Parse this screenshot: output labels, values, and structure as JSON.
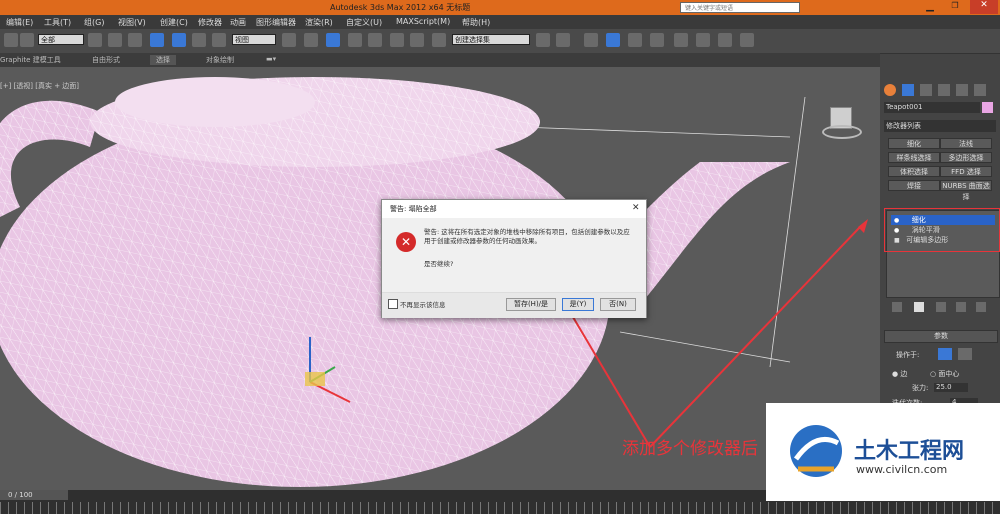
{
  "window": {
    "title": "Autodesk 3ds Max  2012 x64     无标题",
    "search_placeholder": "键入关键字或短语"
  },
  "menu": [
    "编辑(E)",
    "工具(T)",
    "组(G)",
    "视图(V)",
    "创建(C)",
    "修改器",
    "动画",
    "图形编辑器",
    "渲染(R)",
    "自定义(U)",
    "MAXScript(M)",
    "帮助(H)"
  ],
  "toolbar": {
    "selection_filter": "全部",
    "ref_coord": "视图",
    "named_selection": "创建选择集"
  },
  "ribbon": [
    "Graphite 建模工具",
    "自由形式",
    "选择",
    "对象绘制"
  ],
  "viewport": {
    "label": "[+] [透视] [真实 + 边面]"
  },
  "command_panel": {
    "object_name": "Teapot001",
    "modifier_list": "修改器列表",
    "buttons": [
      "细化",
      "法线",
      "样条线选择",
      "多边形选择",
      "体积选择",
      "FFD 选择",
      "焊接",
      "NURBS 曲面选择"
    ],
    "stack": [
      "细化",
      "涡轮平滑",
      "可编辑多边形"
    ],
    "rollout_title": "参数",
    "operate_on": "操作于:",
    "edge": "边",
    "face_center": "面中心",
    "tension_label": "张力:",
    "tension_value": "25.0",
    "iterations_label": "迭代次数:",
    "iterations_value": "4"
  },
  "dialog": {
    "title": "警告: 塌陷全部",
    "message": "警告: 这将在所有选定对象的堆栈中移除所有项目，包括创建参数以及应用于创建或修改器参数的任何动画效果。",
    "question": "是否继续?",
    "checkbox": "不再显示该信息",
    "btn_hold": "暂存(H)/是",
    "btn_yes": "是(Y)",
    "btn_no": "否(N)"
  },
  "annotation": {
    "text": "添加多个修改器后"
  },
  "timeline": {
    "frame": "0 / 100"
  },
  "watermark": {
    "brand": "土木工程网",
    "url": "www.civilcn.com"
  },
  "colors": {
    "accent_orange": "#de6a1c",
    "arrow_red": "#e8343a",
    "mesh_pink": "#e9c6e4",
    "highlight_blue": "#2a63c8"
  }
}
